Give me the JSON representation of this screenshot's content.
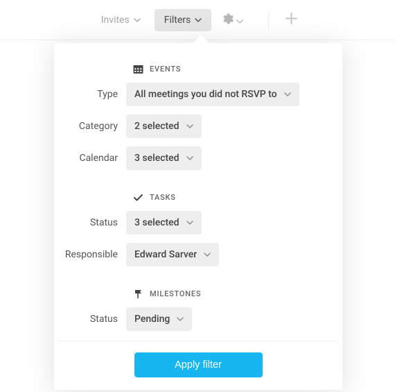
{
  "toolbar": {
    "invites": "Invites",
    "filters": "Filters"
  },
  "sections": {
    "events": {
      "title": "EVENTS",
      "type_label": "Type",
      "type_value": "All meetings you did not RSVP to",
      "category_label": "Category",
      "category_value": "2 selected",
      "calendar_label": "Calendar",
      "calendar_value": "3 selected"
    },
    "tasks": {
      "title": "TASKS",
      "status_label": "Status",
      "status_value": "3 selected",
      "responsible_label": "Responsible",
      "responsible_value": "Edward Sarver"
    },
    "milestones": {
      "title": "MILESTONES",
      "status_label": "Status",
      "status_value": "Pending"
    }
  },
  "actions": {
    "apply": "Apply filter"
  }
}
